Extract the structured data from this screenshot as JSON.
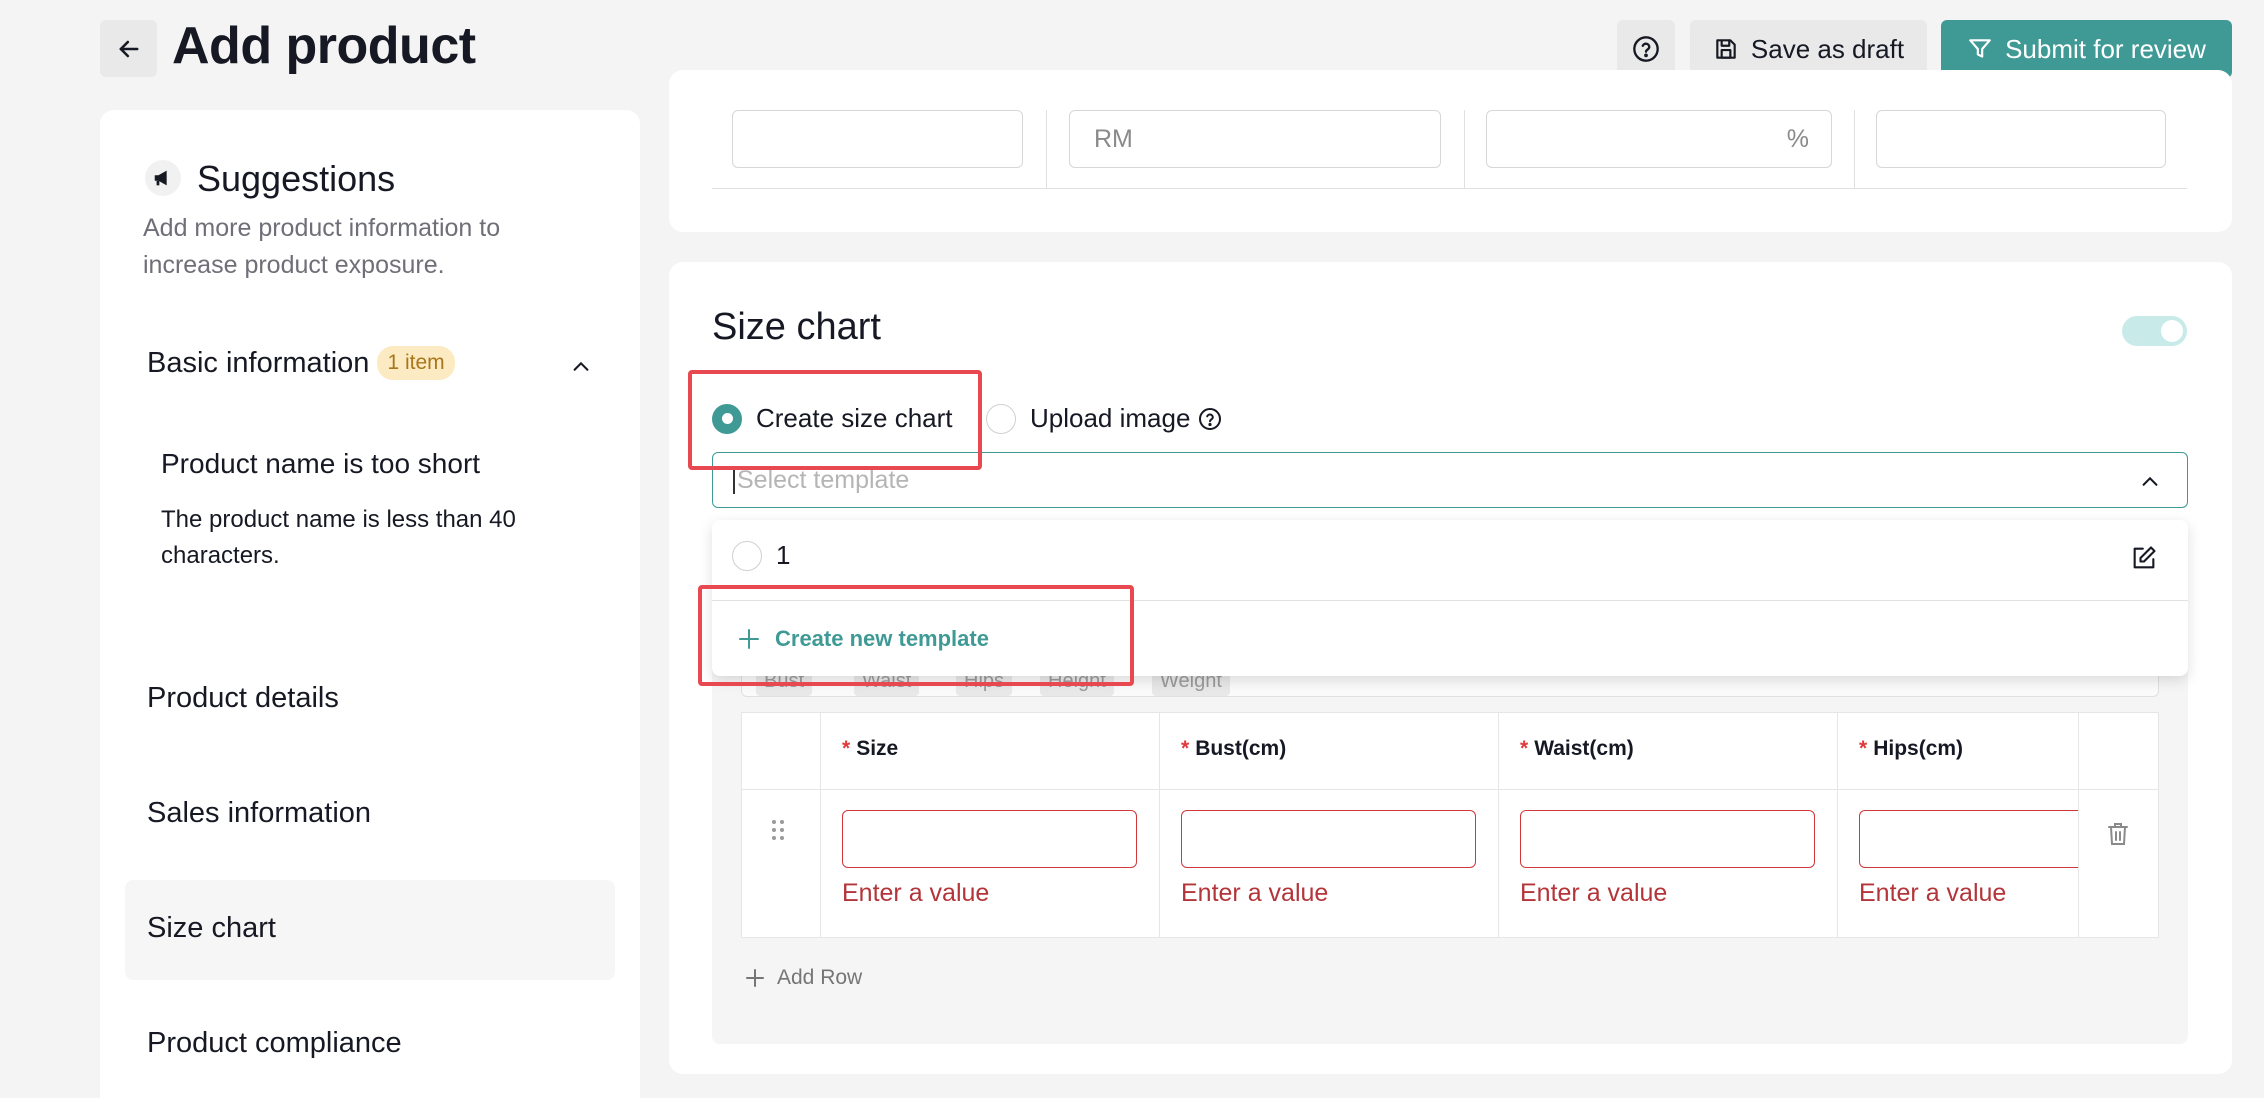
{
  "header": {
    "title": "Add product",
    "save_draft_label": "Save as draft",
    "submit_label": "Submit for review"
  },
  "sidebar": {
    "suggestions_title": "Suggestions",
    "suggestions_desc": "Add more product information to increase product exposure.",
    "basic_info_label": "Basic information",
    "basic_info_badge": "1 item",
    "issue_title": "Product name is too short",
    "issue_desc": "The product name is less than 40 characters.",
    "nav": [
      "Product details",
      "Sales information",
      "Size chart",
      "Product compliance"
    ],
    "active_nav": "Size chart"
  },
  "top_fields": {
    "currency_placeholder": "RM",
    "percent_suffix": "%"
  },
  "size_chart": {
    "title": "Size chart",
    "toggle_on": true,
    "radio_create": "Create size chart",
    "radio_upload": "Upload image",
    "select_placeholder": "Select template",
    "dropdown_option": "1",
    "create_template": "Create new template",
    "chips": [
      "Bust",
      "Waist",
      "Hips",
      "Height",
      "Weight"
    ],
    "columns": [
      "Size",
      "Bust(cm)",
      "Waist(cm)",
      "Hips(cm)"
    ],
    "error_text": "Enter a value",
    "add_row": "Add Row"
  },
  "colors": {
    "accent": "#3f9a96",
    "error": "#d0383c",
    "annotation": "#e8484f"
  }
}
